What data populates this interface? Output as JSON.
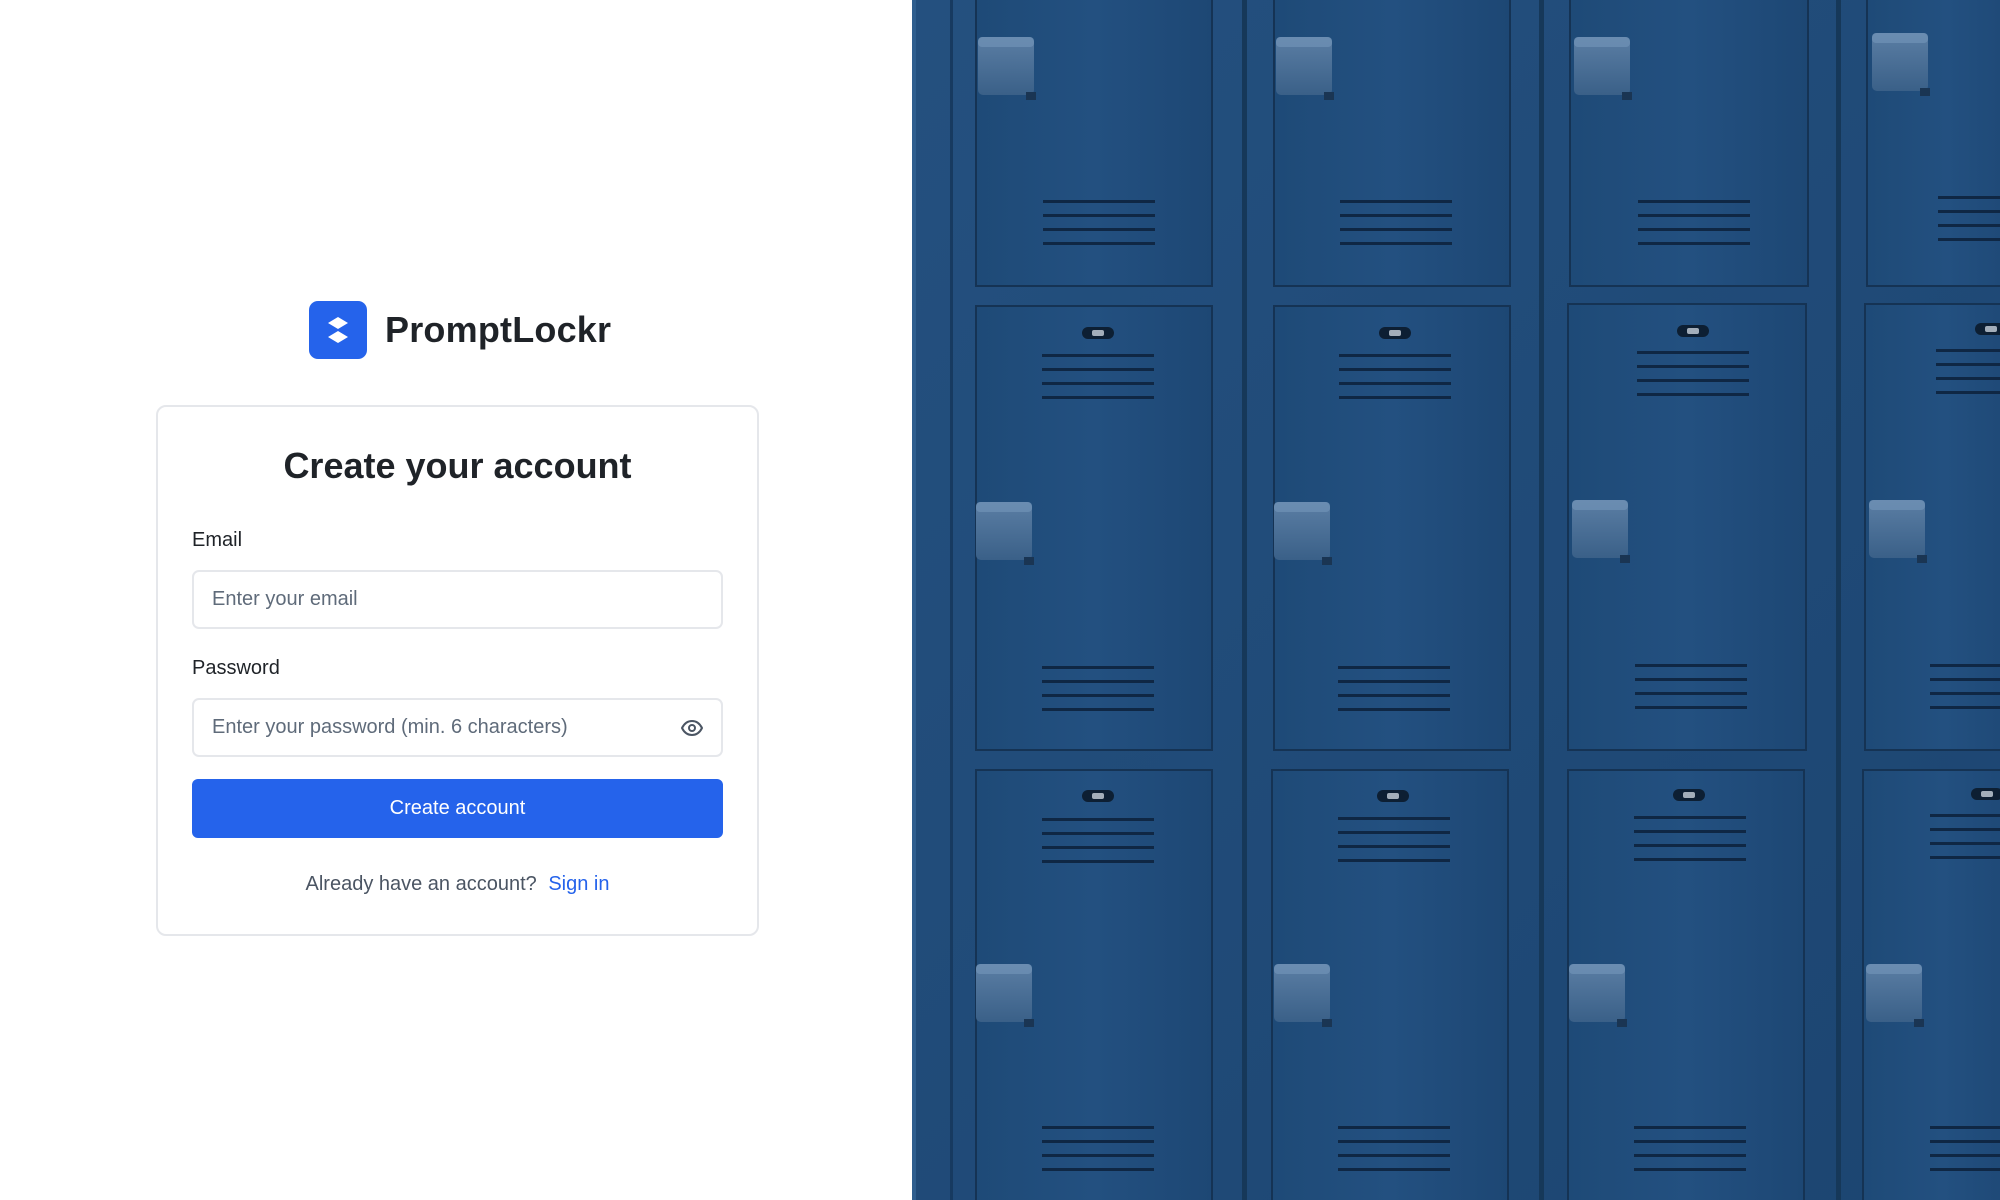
{
  "brand": {
    "name": "PromptLockr",
    "logo_icon": "dropbox-style-icon",
    "accent_color": "#2563eb"
  },
  "form": {
    "title": "Create your account",
    "email_label": "Email",
    "email_placeholder": "Enter your email",
    "password_label": "Password",
    "password_placeholder": "Enter your password (min. 6 characters)",
    "password_toggle_icon": "eye-icon",
    "submit_label": "Create account",
    "signin_prompt": "Already have an account?",
    "signin_link": "Sign in"
  },
  "hero_image": {
    "subject": "blue-lockers-photo",
    "base_color": "#1f4a78"
  }
}
